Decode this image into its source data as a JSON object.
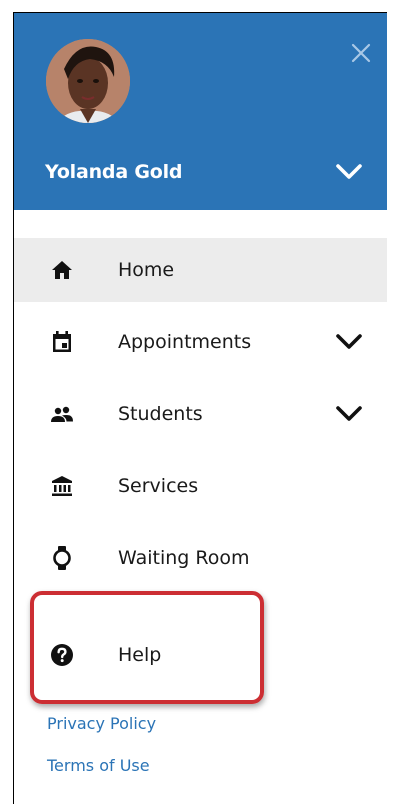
{
  "user": {
    "name": "Yolanda Gold"
  },
  "icons": {
    "close": "close-icon",
    "user_menu": "chevron-down-icon",
    "home": "home-icon",
    "appointments": "calendar-icon",
    "students": "people-icon",
    "services": "institution-icon",
    "waiting_room": "watch-icon",
    "help": "help-circle-icon"
  },
  "nav": {
    "items": [
      {
        "label": "Home",
        "icon": "home-icon",
        "active": true,
        "expandable": false
      },
      {
        "label": "Appointments",
        "icon": "calendar-icon",
        "active": false,
        "expandable": true
      },
      {
        "label": "Students",
        "icon": "people-icon",
        "active": false,
        "expandable": true
      },
      {
        "label": "Services",
        "icon": "institution-icon",
        "active": false,
        "expandable": false
      },
      {
        "label": "Waiting Room",
        "icon": "watch-icon",
        "active": false,
        "expandable": false
      },
      {
        "label": "Help",
        "icon": "help-circle-icon",
        "active": false,
        "expandable": false
      }
    ]
  },
  "footer": {
    "privacy_label": "Privacy Policy",
    "terms_label": "Terms of Use"
  },
  "colors": {
    "header_bg": "#2b74b6",
    "active_bg": "#ececec",
    "highlight_border": "#cc2e33",
    "link": "#2b74b6"
  }
}
